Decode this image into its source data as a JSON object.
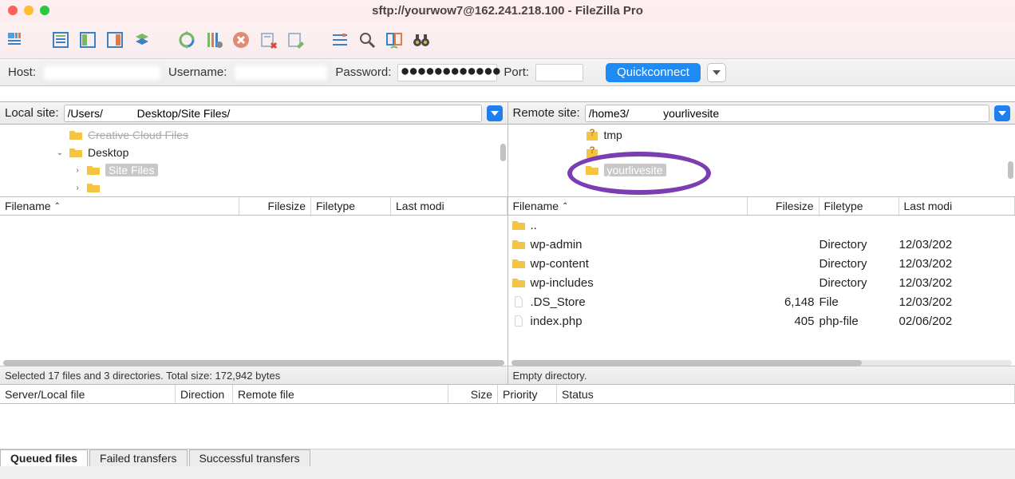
{
  "window": {
    "title": "sftp://yourwow7@162.241.218.100 - FileZilla Pro"
  },
  "toolbar_icons": [
    "site-manager-icon",
    "toggle-log-icon",
    "toggle-local-tree-icon",
    "toggle-remote-tree-icon",
    "toggle-queue-icon",
    "refresh-icon",
    "process-queue-icon",
    "cancel-icon",
    "disconnect-icon",
    "reconnect-icon",
    "filter-icon",
    "search-icon",
    "compare-icon",
    "binoculars-icon"
  ],
  "quickconnect": {
    "host_label": "Host:",
    "host_value": "",
    "username_label": "Username:",
    "username_value": "",
    "password_label": "Password:",
    "password_display": "●●●●●●●●●●●●",
    "port_label": "Port:",
    "port_value": "",
    "button": "Quickconnect"
  },
  "local": {
    "site_label": "Local site:",
    "site_path": "/Users/           Desktop/Site Files/",
    "tree": {
      "prev_item": "Creative Cloud Files",
      "desktop": "Desktop",
      "site_files": "Site Files",
      "other": " "
    },
    "columns": {
      "fname": "Filename",
      "fsize": "Filesize",
      "ftype": "Filetype",
      "fmod": "Last modi"
    },
    "status": "Selected 17 files and 3 directories. Total size: 172,942 bytes"
  },
  "remote": {
    "site_label": "Remote site:",
    "site_path": "/home3/           yourlivesite",
    "tree": {
      "tmp": "tmp",
      "unknown": "...",
      "target": "yourlivesite"
    },
    "columns": {
      "fname": "Filename",
      "fsize": "Filesize",
      "ftype": "Filetype",
      "fmod": "Last modi"
    },
    "files": [
      {
        "name": "..",
        "size": "",
        "type": "",
        "mod": "",
        "icon": "folder"
      },
      {
        "name": "wp-admin",
        "size": "",
        "type": "Directory",
        "mod": "12/03/202",
        "icon": "folder"
      },
      {
        "name": "wp-content",
        "size": "",
        "type": "Directory",
        "mod": "12/03/202",
        "icon": "folder"
      },
      {
        "name": "wp-includes",
        "size": "",
        "type": "Directory",
        "mod": "12/03/202",
        "icon": "folder"
      },
      {
        "name": ".DS_Store",
        "size": "6,148",
        "type": "File",
        "mod": "12/03/202",
        "icon": "file"
      },
      {
        "name": "index.php",
        "size": "405",
        "type": "php-file",
        "mod": "02/06/202",
        "icon": "file"
      }
    ],
    "status": "Empty directory."
  },
  "queue": {
    "columns": {
      "server": "Server/Local file",
      "dir": "Direction",
      "remote": "Remote file",
      "size": "Size",
      "prio": "Priority",
      "status": "Status"
    }
  },
  "tabs": {
    "queued": "Queued files",
    "failed": "Failed transfers",
    "success": "Successful transfers"
  }
}
